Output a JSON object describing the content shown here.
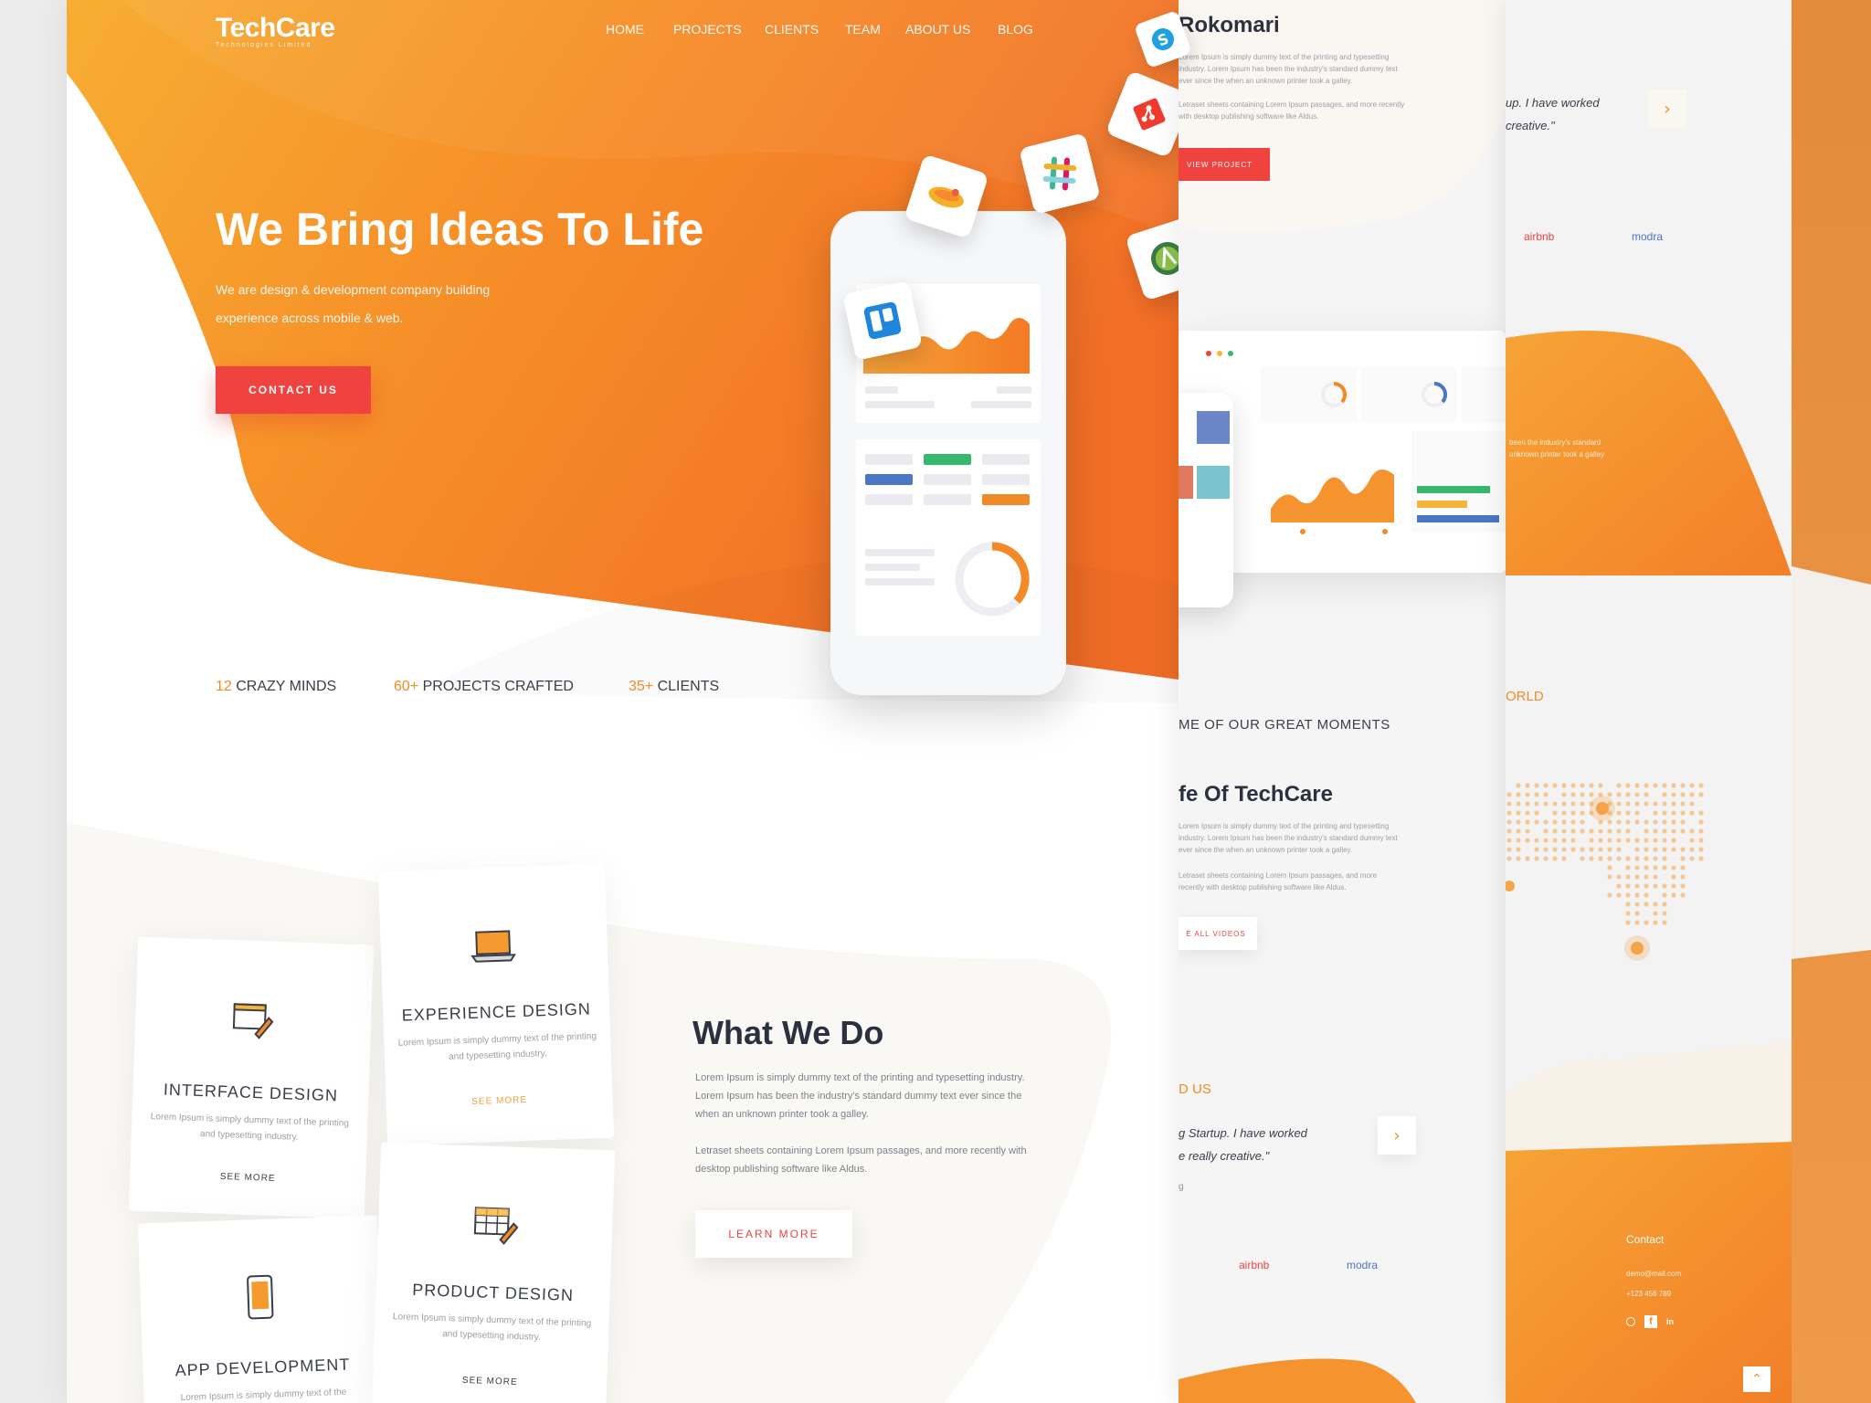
{
  "brand": {
    "name": "TechCare",
    "tagline": "Technologies Limited"
  },
  "nav": [
    "HOME",
    "PROJECTS",
    "CLIENTS",
    "TEAM",
    "ABOUT US",
    "BLOG"
  ],
  "hero": {
    "title": "We Bring Ideas To Life",
    "subtitle_line1": "We are design & development company building",
    "subtitle_line2": "experience across mobile & web.",
    "cta": "CONTACT US"
  },
  "stats": [
    {
      "num": "12",
      "label": "CRAZY MINDS"
    },
    {
      "num": "60+",
      "label": "PROJECTS CRAFTED"
    },
    {
      "num": "35+",
      "label": "CLIENTS"
    }
  ],
  "services": [
    {
      "title": "INTERFACE DESIGN",
      "text": "Lorem Ipsum is simply dummy text of the printing and typesetting industry.",
      "more": "SEE MORE"
    },
    {
      "title": "EXPERIENCE DESIGN",
      "text": "Lorem Ipsum is simply dummy text of the printing and typesetting industry.",
      "more": "SEE MORE"
    },
    {
      "title": "APP DEVELOPMENT",
      "text": "Lorem Ipsum is simply dummy text of the",
      "more": ""
    },
    {
      "title": "PRODUCT DESIGN",
      "text": "Lorem Ipsum is simply dummy text of the printing and typesetting industry.",
      "more": "SEE MORE"
    }
  ],
  "what_we_do": {
    "title": "What We Do",
    "p1": "Lorem Ipsum is simply dummy text of the printing and typesetting industry. Lorem Ipsum has been the industry's standard dummy text ever since the when an unknown printer took a galley.",
    "p2": "Letraset sheets containing Lorem Ipsum passages, and more recently with desktop publishing software like Aldus.",
    "cta": "LEARN MORE"
  },
  "panel2": {
    "project_title": "Rokomari",
    "project_p1": "Lorem Ipsum is simply dummy text of the printing and typesetting industry. Lorem Ipsum has been the industry's standard dummy text ever since the when an unknown printer took a galley.",
    "project_p2": "Letraset sheets containing Lorem Ipsum passages, and more recently with desktop publishing software like Aldus.",
    "project_cta": "VIEW PROJECT",
    "moments_label": "ME OF OUR GREAT MOMENTS",
    "life_title": "fe Of TechCare",
    "life_p1": "Lorem Ipsum is simply dummy text of the printing and typesetting industry. Lorem Ipsum has been the industry's standard dummy text ever since the when an unknown printer took a galley.",
    "life_p2": "Letraset sheets containing Lorem Ipsum passages, and more recently with desktop publishing software like Aldus.",
    "videos_cta": "E ALL VIDEOS",
    "about_label": "D US",
    "quote_line1": "g Startup. I have worked",
    "quote_line2": "e really creative.\"",
    "quote_name": "g",
    "client1": "airbnb",
    "client2": "modra"
  },
  "panel3": {
    "quote_line1": "up. I have worked",
    "quote_line2": "creative.\"",
    "client1": "airbnb",
    "client2": "modra",
    "world_label": "ORLD",
    "orange_text": "been the industry's standard",
    "orange_text2": "unknown printer took a galley",
    "contact_label": "Contact",
    "contact_email": "demo@mail.com",
    "contact_phone": "+123 456 789"
  },
  "colors": {
    "orange": "#f58a28",
    "orange_light": "#f7b43a",
    "red": "#f0423e",
    "text_dark": "#2c3140"
  }
}
